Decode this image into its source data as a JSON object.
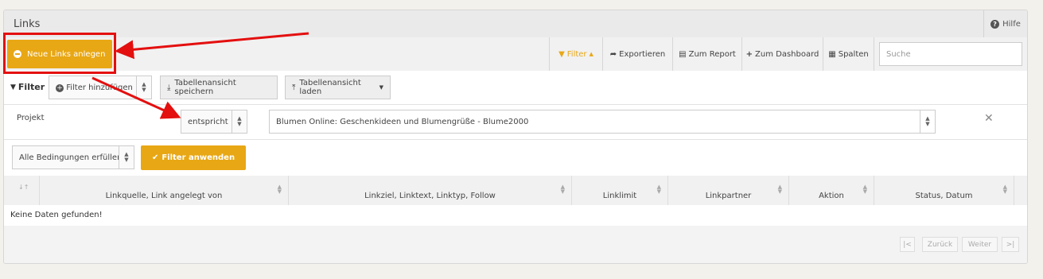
{
  "header": {
    "title": "Links",
    "help_label": "Hilfe",
    "help_icon": "help-circle-icon"
  },
  "toolbar": {
    "new_button": "Neue Links anlegen",
    "filter_button": "Filter",
    "export_button": "Exportieren",
    "report_button": "Zum Report",
    "dashboard_button": "Zum Dashboard",
    "columns_button": "Spalten",
    "search_placeholder": "Suche",
    "accent_color": "#e8a714"
  },
  "filterbar": {
    "label": "Filter",
    "add_filter": "Filter hinzufügen",
    "save_view": "Tabellenansicht speichern",
    "load_view": "Tabellenansicht laden"
  },
  "filter_rule": {
    "field": "Projekt",
    "operator": "entspricht",
    "value": "Blumen Online: Geschenkideen und Blumengrüße - Blume2000"
  },
  "apply_row": {
    "condition_mode": "Alle Bedingungen erfüllen",
    "apply_button": "Filter anwenden"
  },
  "table": {
    "columns": [
      "Linkquelle, Link angelegt von",
      "Linkziel, Linktext, Linktyp, Follow",
      "Linklimit",
      "Linkpartner",
      "Aktion",
      "Status, Datum"
    ],
    "empty_message": "Keine Daten gefunden!"
  },
  "pagination": {
    "first": "|<",
    "prev": "Zurück",
    "next": "Weiter",
    "last": ">|"
  },
  "annotation_color": "#e40f0f"
}
